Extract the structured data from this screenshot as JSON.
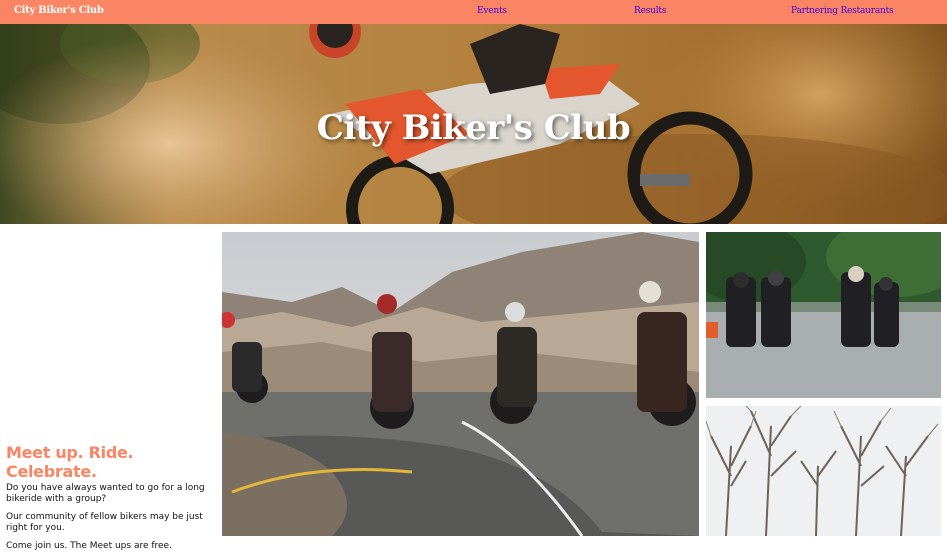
{
  "nav": {
    "brand": "City Biker's Club",
    "links": [
      "Events",
      "Results",
      "Partnering Restaurants"
    ]
  },
  "hero": {
    "title": "City Biker's Club"
  },
  "intro": {
    "headline": "Meet up. Ride. Celebrate.",
    "paragraphs": [
      "Do you have always wanted to go for a long bikeride with a group?",
      "Our community of fellow bikers may be just right for you.",
      "Come join us. The Meet ups are free."
    ]
  },
  "colors": {
    "nav_background": "#fa8564",
    "link_color": "#3b00e6",
    "headline_color": "#fa8564"
  }
}
